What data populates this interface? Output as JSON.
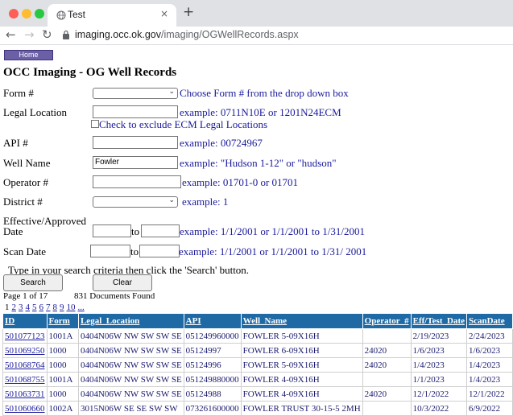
{
  "browser": {
    "tab_title": "Test",
    "tab_close": "×",
    "new_tab": "+",
    "back": "←",
    "forward": "→",
    "reload": "↻",
    "url_host": "imaging.occ.ok.gov",
    "url_path": "/imaging/OGWellRecords.aspx"
  },
  "page": {
    "home_label": "Home",
    "title": "OCC Imaging - OG Well Records"
  },
  "form": {
    "form_num": {
      "label": "Form #",
      "hint": "Choose Form # from the drop down box",
      "value": ""
    },
    "legal": {
      "label": "Legal Location",
      "hint": "example: 0711N10E or 1201N24ECM",
      "value": "",
      "checkbox_label": "Check to exclude ECM Legal Locations",
      "checked": false
    },
    "api": {
      "label": "API #",
      "hint": "example: 00724967",
      "value": ""
    },
    "well_name": {
      "label": "Well Name",
      "hint": "example: \"Hudson 1-12\" or \"hudson\"",
      "value": "Fowler"
    },
    "operator": {
      "label": "Operator #",
      "hint": "example: 01701-0 or 01701",
      "value": ""
    },
    "district": {
      "label": "District #",
      "hint": "example: 1",
      "value": ""
    },
    "effective": {
      "label_line1": "Effective/Approved",
      "label_line2": "Date",
      "to": "to",
      "hint": "example: 1/1/2001 or 1/1/2001 to 1/31/2001",
      "from_value": "",
      "to_value": ""
    },
    "scan": {
      "label": "Scan Date",
      "to": "to",
      "hint": "example: 1/1/2001 or 1/1/2001 to 1/31/ 2001",
      "from_value": "",
      "to_value": ""
    }
  },
  "instructions": "Type in your search criteria then click the 'Search' button.",
  "buttons": {
    "search": "Search",
    "clear": "Clear"
  },
  "results": {
    "page_info": "Page 1 of 17",
    "docs_found": "831 Documents Found",
    "current_page": "1",
    "page_links": [
      "2",
      "3",
      "4",
      "5",
      "6",
      "7",
      "8",
      "9",
      "10",
      "..."
    ],
    "columns": [
      "ID",
      "Form",
      "Legal_Location",
      "API",
      "Well_Name",
      "Operator_#",
      "Eff/Test_Date",
      "ScanDate"
    ],
    "rows": [
      [
        "501077123",
        "1001A",
        "0404N06W NW SW SW SE",
        "051249960000",
        "FOWLER 5-09X16H",
        "",
        "2/19/2023",
        "2/24/2023"
      ],
      [
        "501069250",
        "1000",
        "0404N06W NW SW SW SE",
        "05124997",
        "FOWLER 6-09X16H",
        "24020",
        "1/6/2023",
        "1/6/2023"
      ],
      [
        "501068764",
        "1000",
        "0404N06W NW SW SW SE",
        "05124996",
        "FOWLER 5-09X16H",
        "24020",
        "1/4/2023",
        "1/4/2023"
      ],
      [
        "501068755",
        "1001A",
        "0404N06W NW SW SW SE",
        "051249880000",
        "FOWLER 4-09X16H",
        "",
        "1/1/2023",
        "1/4/2023"
      ],
      [
        "501063731",
        "1000",
        "0404N06W NW SW SW SE",
        "05124988",
        "FOWLER 4-09X16H",
        "24020",
        "12/1/2022",
        "12/1/2022"
      ],
      [
        "501060660",
        "1002A",
        "3015N06W SE SE SW SW",
        "073261600000",
        "FOWLER TRUST 30-15-5 2MH",
        "",
        "10/3/2022",
        "6/9/2022"
      ]
    ]
  }
}
